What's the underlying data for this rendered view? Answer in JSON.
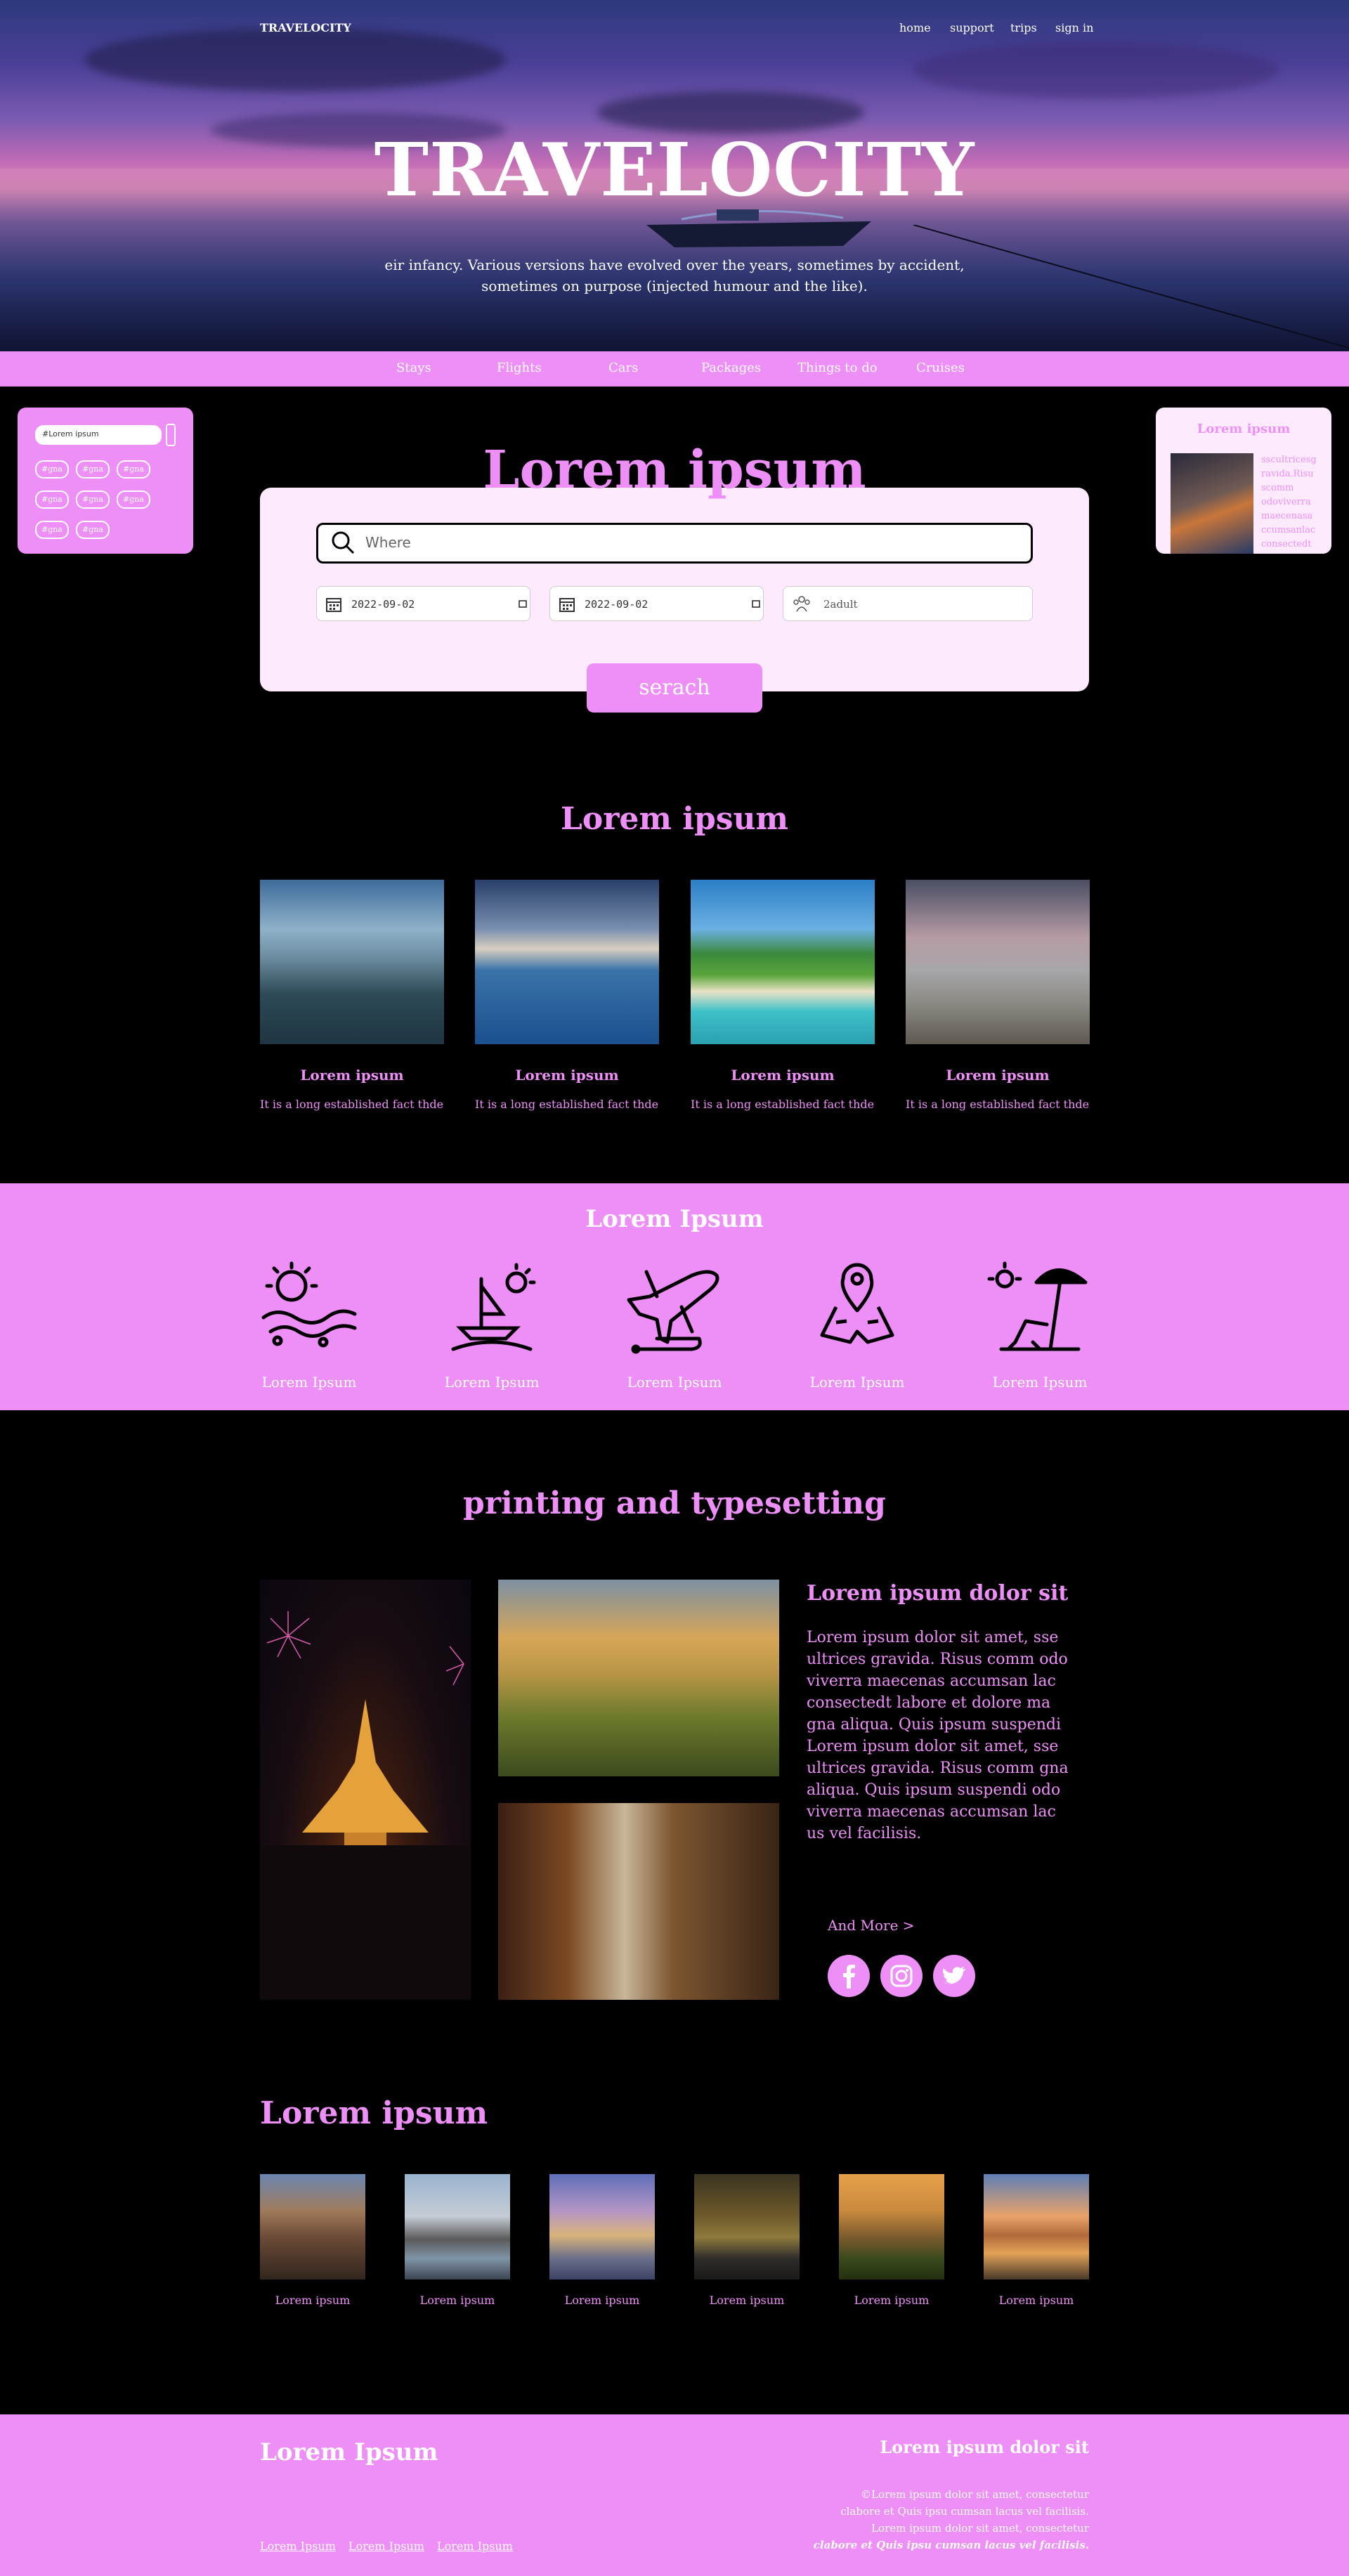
{
  "header": {
    "brand": "TRAVELOCITY",
    "nav": [
      "home",
      "support",
      "trips",
      "sign in"
    ],
    "hero_title": "TRAVELOCITY",
    "hero_subtitle": "eir infancy. Various versions have evolved over the years, sometimes by accident, sometimes on purpose (injected humour and the like)."
  },
  "categories": [
    "Stays",
    "Flights",
    "Cars",
    "Packages",
    "Things to do",
    "Cruises"
  ],
  "left_widget": {
    "search_value": "#Lorem ipsum",
    "tags": [
      "#gna",
      "#gna",
      "#gna",
      "#gna",
      "#gna",
      "#gna",
      "#gna",
      "#gna"
    ]
  },
  "right_widget": {
    "title": "Lorem ipsum",
    "text": "sscultricesg ravida.Risu scomm odoviverra maecenasa ccumsanlac consectedt"
  },
  "search": {
    "title": "Lorem ipsum",
    "where_placeholder": "Where",
    "date_from": "2022-09-02",
    "date_to": "2022-09-02",
    "guests": "2adult",
    "button": "serach"
  },
  "destinations": {
    "title": "Lorem ipsum",
    "items": [
      {
        "name": "Lorem ipsum",
        "desc": "It is a long established fact thder w"
      },
      {
        "name": "Lorem ipsum",
        "desc": "It is a long established fact thder w"
      },
      {
        "name": "Lorem ipsum",
        "desc": "It is a long established fact thder w"
      },
      {
        "name": "Lorem ipsum",
        "desc": "It is a long established fact thder w"
      }
    ]
  },
  "features": {
    "title": "Lorem Ipsum",
    "items": [
      {
        "label": "Lorem Ipsum",
        "icon": "beach-sun-waves-icon"
      },
      {
        "label": "Lorem Ipsum",
        "icon": "island-boat-icon"
      },
      {
        "label": "Lorem Ipsum",
        "icon": "airplane-icon"
      },
      {
        "label": "Lorem Ipsum",
        "icon": "map-pin-icon"
      },
      {
        "label": "Lorem Ipsum",
        "icon": "beach-chair-umbrella-icon"
      }
    ]
  },
  "article": {
    "section_title": "printing and typesetting",
    "title": "Lorem ipsum dolor sit",
    "body": "Lorem ipsum dolor sit amet, sse ultrices gravida. Risus comm odo viverra maecenas accumsan lac consectedt labore et dolore ma gna aliqua. Quis ipsum suspendi Lorem ipsum dolor sit amet, sse ultrices gravida. Risus comm gna aliqua. Quis ipsum suspendi odo viverra maecenas accumsan lac us vel facilisis.",
    "more": "And More >",
    "social": [
      "facebook-icon",
      "instagram-icon",
      "twitter-icon"
    ]
  },
  "gallery": {
    "title": "Lorem ipsum",
    "captions": [
      "Lorem ipsum",
      "Lorem ipsum",
      "Lorem ipsum",
      "Lorem ipsum",
      "Lorem ipsum",
      "Lorem ipsum"
    ]
  },
  "footer": {
    "title": "Lorem Ipsum",
    "links": [
      "Lorem Ipsum",
      "Lorem Ipsum",
      "Lorem Ipsum"
    ],
    "right_title": "Lorem ipsum dolor sit",
    "notes": [
      "©Lorem ipsum dolor sit amet, consectetur",
      "clabore et Quis ipsu cumsan lacus vel facilisis.",
      "Lorem ipsum dolor sit amet, consectetur",
      "clabore et Quis ipsu cumsan lacus vel facilisis."
    ]
  },
  "colors": {
    "accent": "#ee8ff8",
    "card": "#fdeafc",
    "background": "#000000"
  }
}
